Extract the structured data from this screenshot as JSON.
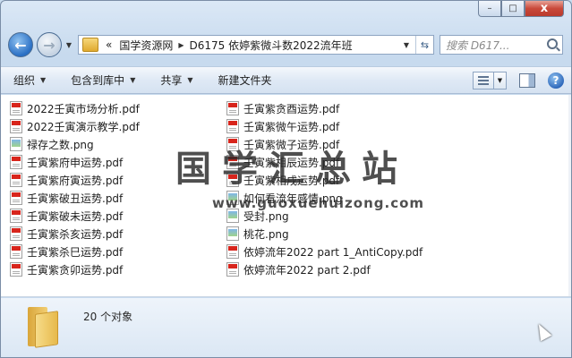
{
  "window": {
    "caption_buttons": {
      "minimize": "–",
      "maximize": "□",
      "close": "x"
    }
  },
  "navbar": {
    "back_glyph": "←",
    "forward_glyph": "→",
    "address_segments": [
      "«",
      "国学资源网",
      "D6175 依婷紫微斗数2022流年班"
    ],
    "search_placeholder": "搜索 D617..."
  },
  "toolbar": {
    "organize": "组织",
    "include_library": "包含到库中",
    "share": "共享",
    "new_folder": "新建文件夹",
    "help": "?"
  },
  "files_col1": [
    {
      "name": "2022壬寅市场分析.pdf",
      "type": "pdf"
    },
    {
      "name": "2022壬寅演示教学.pdf",
      "type": "pdf"
    },
    {
      "name": "禄存之数.png",
      "type": "png"
    },
    {
      "name": "壬寅紫府申运势.pdf",
      "type": "pdf"
    },
    {
      "name": "壬寅紫府寅运势.pdf",
      "type": "pdf"
    },
    {
      "name": "壬寅紫破丑运势.pdf",
      "type": "pdf"
    },
    {
      "name": "壬寅紫破未运势.pdf",
      "type": "pdf"
    },
    {
      "name": "壬寅紫杀亥运势.pdf",
      "type": "pdf"
    },
    {
      "name": "壬寅紫杀巳运势.pdf",
      "type": "pdf"
    },
    {
      "name": "壬寅紫贪卯运势.pdf",
      "type": "pdf"
    }
  ],
  "files_col2": [
    {
      "name": "壬寅紫贪酉运势.pdf",
      "type": "pdf"
    },
    {
      "name": "壬寅紫微午运势.pdf",
      "type": "pdf"
    },
    {
      "name": "壬寅紫微子运势.pdf",
      "type": "pdf"
    },
    {
      "name": "壬寅紫相辰运势.pdf",
      "type": "pdf"
    },
    {
      "name": "壬寅紫相戌运势.pdf",
      "type": "pdf"
    },
    {
      "name": "如何看流年感情.png",
      "type": "png"
    },
    {
      "name": "受封.png",
      "type": "png"
    },
    {
      "name": "桃花.png",
      "type": "png"
    },
    {
      "name": "依婷流年2022 part 1_AntiCopy.pdf",
      "type": "pdf"
    },
    {
      "name": "依婷流年2022 part 2.pdf",
      "type": "pdf"
    }
  ],
  "watermark": {
    "text": "国学汇总站",
    "url": "www.guoxuehuizong.com"
  },
  "details": {
    "count_text": "20 个对象"
  }
}
